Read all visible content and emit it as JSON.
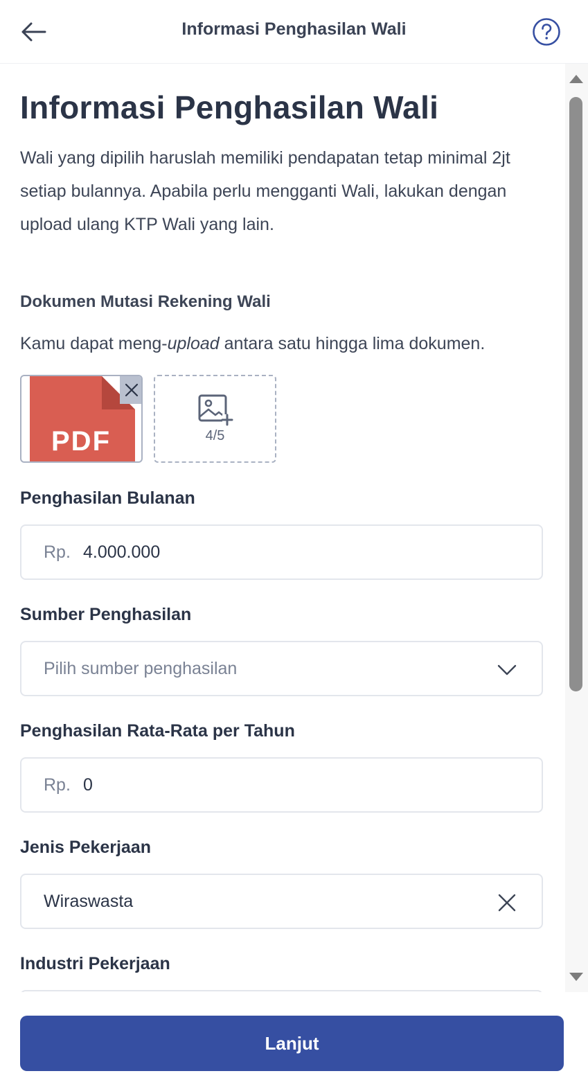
{
  "header": {
    "title": "Informasi Penghasilan Wali",
    "back_icon": "arrow-left-icon",
    "help_icon": "question-circle-icon"
  },
  "page": {
    "title": "Informasi Penghasilan Wali",
    "description": "Wali yang dipilih haruslah memiliki pendapatan tetap minimal 2jt setiap bulannya. Apabila perlu mengganti Wali, lakukan dengan upload ulang KTP Wali yang lain."
  },
  "document": {
    "label": "Dokumen Mutasi Rekening Wali",
    "hint_before": "Kamu dapat meng-",
    "hint_italic": "upload",
    "hint_after": " antara satu hingga lima dokumen.",
    "file_type": "PDF",
    "slot_count": "4/5"
  },
  "fields": {
    "monthly_income": {
      "label": "Penghasilan Bulanan",
      "prefix": "Rp.",
      "value": "4.000.000"
    },
    "income_source": {
      "label": "Sumber Penghasilan",
      "placeholder": "Pilih sumber penghasilan"
    },
    "annual_income": {
      "label": "Penghasilan Rata-Rata per Tahun",
      "prefix": "Rp.",
      "value": "0"
    },
    "job_type": {
      "label": "Jenis Pekerjaan",
      "value": "Wiraswasta"
    },
    "industry": {
      "label": "Industri Pekerjaan"
    }
  },
  "footer": {
    "button_label": "Lanjut"
  },
  "colors": {
    "primary": "#364fa2",
    "pdf_red": "#d95e52",
    "pdf_fold": "#b5473d",
    "text": "#2b3447",
    "muted": "#7a8294"
  }
}
